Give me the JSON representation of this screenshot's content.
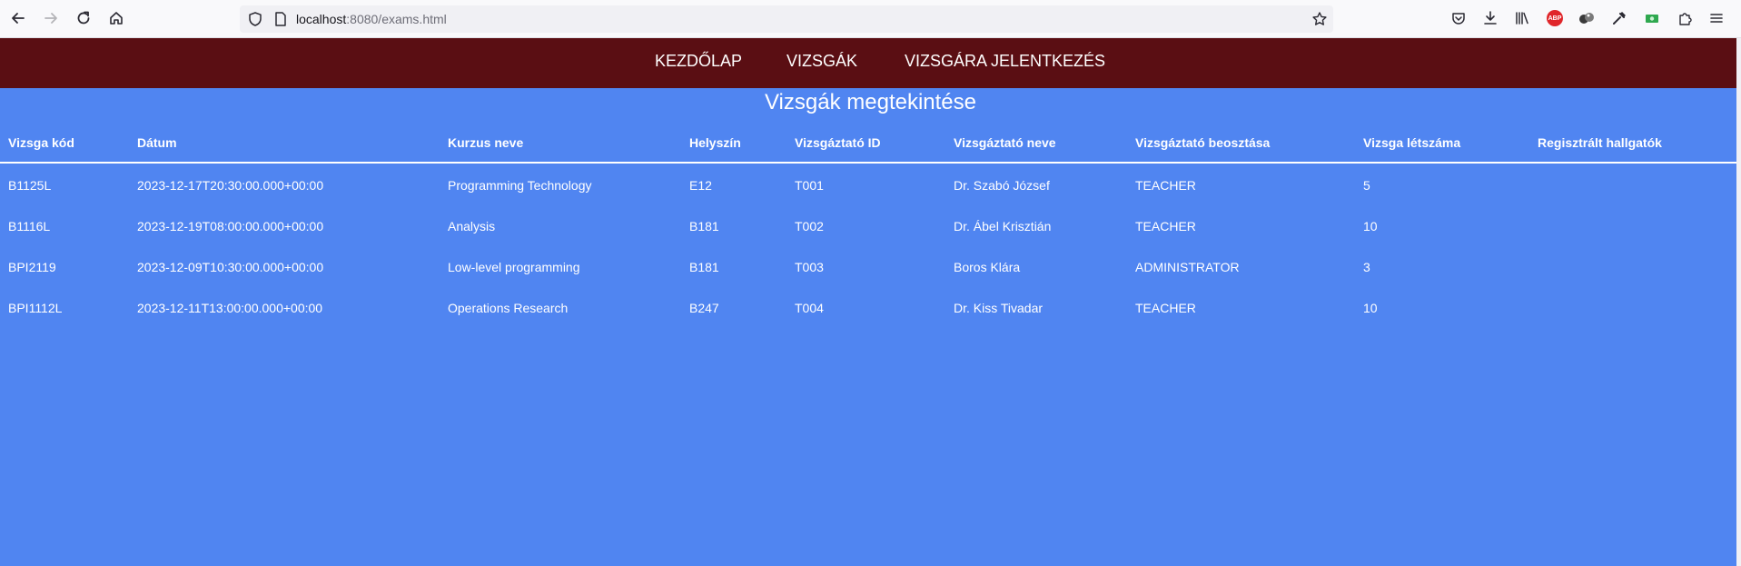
{
  "browser": {
    "url_host": "localhost",
    "url_path": ":8080/exams.html",
    "abp_label": "ABP"
  },
  "nav": {
    "home": "KEZDŐLAP",
    "exams": "VIZSGÁK",
    "register": "VIZSGÁRA JELENTKEZÉS"
  },
  "page": {
    "title": "Vizsgák megtekintése"
  },
  "table": {
    "headers": [
      "Vizsga kód",
      "Dátum",
      "Kurzus neve",
      "Helyszín",
      "Vizsgáztató ID",
      "Vizsgáztató neve",
      "Vizsgáztató beosztása",
      "Vizsga létszáma",
      "Regisztrált hallgatók"
    ],
    "rows": [
      [
        "B1125L",
        "2023-12-17T20:30:00.000+00:00",
        "Programming Technology",
        "E12",
        "T001",
        "Dr. Szabó József",
        "TEACHER",
        "5",
        ""
      ],
      [
        "B1116L",
        "2023-12-19T08:00:00.000+00:00",
        "Analysis",
        "B181",
        "T002",
        "Dr. Ábel Krisztián",
        "TEACHER",
        "10",
        ""
      ],
      [
        "BPI2119",
        "2023-12-09T10:30:00.000+00:00",
        "Low-level programming",
        "B181",
        "T003",
        "Boros Klára",
        "ADMINISTRATOR",
        "3",
        ""
      ],
      [
        "BPI1112L",
        "2023-12-11T13:00:00.000+00:00",
        "Operations Research",
        "B247",
        "T004",
        "Dr. Kiss Tivadar",
        "TEACHER",
        "10",
        ""
      ]
    ]
  },
  "colors": {
    "nav_bg": "#5a0e13",
    "page_bg": "#5085f1",
    "text": "#ffffff"
  }
}
